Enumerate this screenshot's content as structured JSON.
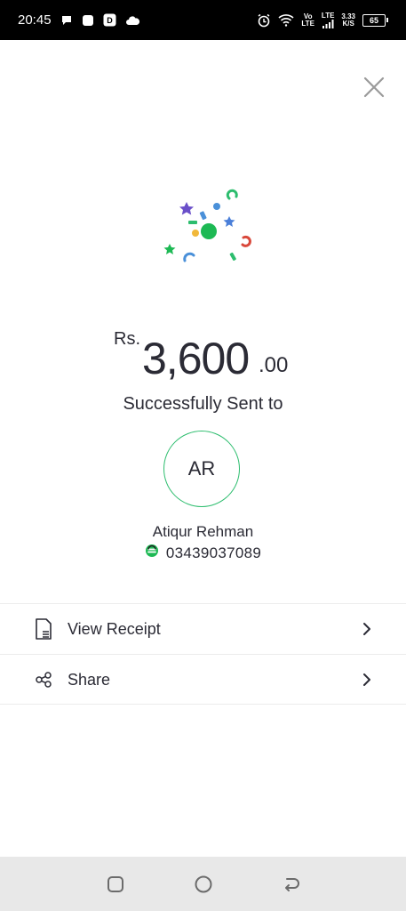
{
  "status_bar": {
    "time": "20:45",
    "network_top": "Vo",
    "network_bottom": "LTE",
    "lte_label": "LTE",
    "speed_value": "3.33",
    "speed_unit": "K/S",
    "battery": "65"
  },
  "transaction": {
    "currency": "Rs.",
    "amount_main": "3,600",
    "amount_decimal": ".00",
    "status_text": "Successfully Sent to"
  },
  "recipient": {
    "initials": "AR",
    "name": "Atiqur Rehman",
    "phone": "03439037089"
  },
  "actions": [
    {
      "label": "View Receipt",
      "icon": "receipt-icon"
    },
    {
      "label": "Share",
      "icon": "share-icon"
    }
  ],
  "colors": {
    "accent_green": "#2dbd6e",
    "text_dark": "#2b2b35"
  }
}
